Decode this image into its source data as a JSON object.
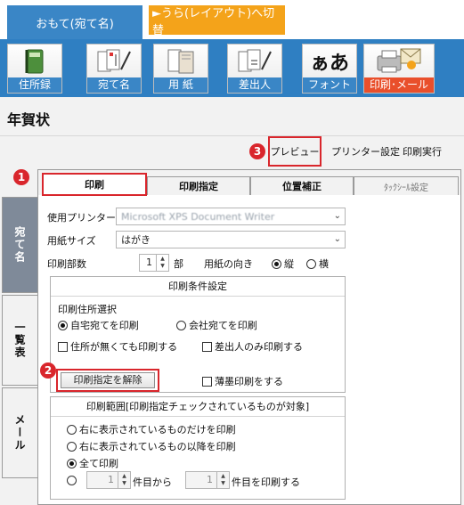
{
  "top_tabs": {
    "front": "おもて(宛て名)",
    "back": "►うら(レイアウト)へ切替"
  },
  "ribbon": {
    "items": [
      {
        "label": "住所録",
        "icon": "address-book-icon"
      },
      {
        "label": "宛て名",
        "icon": "addressed-cards-icon"
      },
      {
        "label": "用 紙",
        "icon": "paper-icon"
      },
      {
        "label": "差出人",
        "icon": "sender-icon"
      },
      {
        "label": "フォント",
        "icon": "font-icon"
      },
      {
        "label": "印刷･メール",
        "icon": "printer-mail-icon",
        "active": true
      }
    ],
    "font_glyph": "ぁあ"
  },
  "page_title": "年賀状",
  "actions": {
    "preview": "プレビュー",
    "printer_settings": "プリンター設定",
    "print_exec": "印刷実行"
  },
  "badges": {
    "b1": "1",
    "b2": "2",
    "b3": "3"
  },
  "side_tabs": {
    "atena": "宛て名",
    "list": "一覧表",
    "mail": "メール"
  },
  "inner_tabs": {
    "print": "印刷",
    "spec": "印刷指定",
    "pos": "位置補正",
    "tack": "ﾀｯｸｼｰﾙ設定"
  },
  "form": {
    "printer_label": "使用プリンター",
    "printer_value": "Microsoft XPS Document Writer",
    "paper_label": "用紙サイズ",
    "paper_value": "はがき",
    "copies_label": "印刷部数",
    "copies_value": "1",
    "copies_unit": "部",
    "orient_label": "用紙の向き",
    "orient_portrait": "縦",
    "orient_landscape": "横"
  },
  "conditions": {
    "title": "印刷条件設定",
    "addr_select": "印刷住所選択",
    "home": "自宅宛てを印刷",
    "company": "会社宛てを印刷",
    "no_addr": "住所が無くても印刷する",
    "sender_only": "差出人のみ印刷する",
    "release_btn": "印刷指定を解除",
    "thin_ink": "薄墨印刷をする"
  },
  "range": {
    "title": "印刷範囲[印刷指定チェックされているものが対象]",
    "opt1": "右に表示されているものだけを印刷",
    "opt2": "右に表示されているもの以降を印刷",
    "opt3": "全て印刷",
    "from_value": "1",
    "from_label": "件目から",
    "to_value": "1",
    "to_label": "件目を印刷する"
  }
}
